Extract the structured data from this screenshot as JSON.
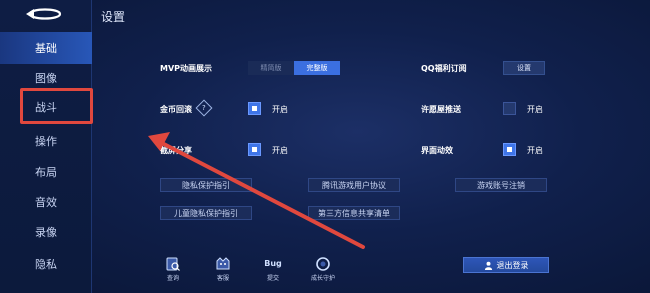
{
  "page": {
    "title": "设置"
  },
  "sidebar": {
    "items": [
      {
        "label": "基础",
        "active": true
      },
      {
        "label": "图像",
        "active": false
      },
      {
        "label": "战斗",
        "active": false
      },
      {
        "label": "操作",
        "active": false
      },
      {
        "label": "布局",
        "active": false
      },
      {
        "label": "音效",
        "active": false
      },
      {
        "label": "录像",
        "active": false
      },
      {
        "label": "隐私",
        "active": false
      }
    ]
  },
  "settings": {
    "mvp": {
      "label": "MVP动画展示",
      "options": [
        "精简版",
        "完整版"
      ],
      "selected": "完整版"
    },
    "qq_sub": {
      "label": "QQ福利订阅",
      "button": "设置"
    },
    "coin": {
      "label": "金币回滚",
      "option": "开启",
      "checked": true
    },
    "wish": {
      "label": "许愿屋推送",
      "option": "开启",
      "checked": false
    },
    "share": {
      "label": "截屏分享",
      "option": "开启",
      "checked": true
    },
    "ui_anim": {
      "label": "界面动效",
      "option": "开启",
      "checked": true
    }
  },
  "links": {
    "privacy": "隐私保护指引",
    "user_agreement": "腾讯游戏用户协议",
    "cancel_account": "游戏账号注销",
    "child_privacy": "儿童隐私保护指引",
    "third_party": "第三方信息共享清单"
  },
  "bottom_bar": {
    "query": "查询",
    "service": "客服",
    "bug": "提交",
    "bug_badge": "Bug",
    "guardian": "成长守护",
    "logout": "退出登录"
  },
  "colors": {
    "accent": "#3f75e8",
    "highlight": "#e0483e",
    "background": "#10204c"
  }
}
